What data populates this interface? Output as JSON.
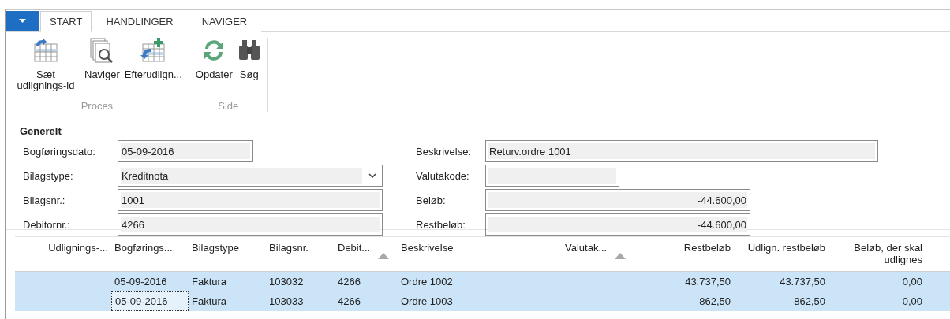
{
  "ribbon": {
    "tabs": [
      {
        "label": "START",
        "selected": true
      },
      {
        "label": "HANDLINGER",
        "selected": false
      },
      {
        "label": "NAVIGER",
        "selected": false
      }
    ],
    "groups": [
      {
        "label": "Proces",
        "buttons": [
          {
            "label": "Sæt udlignings-id",
            "kind": "set-id"
          },
          {
            "label": "Naviger",
            "kind": "navigate"
          },
          {
            "label": "Efterudlign...",
            "kind": "post"
          }
        ]
      },
      {
        "label": "Side",
        "buttons": [
          {
            "label": "Opdater",
            "kind": "refresh"
          },
          {
            "label": "Søg",
            "kind": "find"
          }
        ]
      }
    ]
  },
  "general": {
    "title": "Generelt",
    "left_fields": [
      {
        "label": "Bogføringsdato:",
        "value": "05-09-2016",
        "kind": "text"
      },
      {
        "label": "Bilagstype:",
        "value": "Kreditnota",
        "kind": "select"
      },
      {
        "label": "Bilagsnr.:",
        "value": "1001",
        "kind": "text"
      },
      {
        "label": "Debitornr.:",
        "value": "4266",
        "kind": "text"
      }
    ],
    "right_fields": [
      {
        "label": "Beskrivelse:",
        "value": "Returv.ordre 1001",
        "kind": "text"
      },
      {
        "label": "Valutakode:",
        "kind": "text"
      },
      {
        "label": "Beløb:",
        "value": "-44.600,00",
        "kind": "amount"
      },
      {
        "label": "Restbeløb:",
        "value": "-44.600,00",
        "kind": "amount"
      }
    ]
  },
  "table": {
    "columns": [
      {
        "label": "Udlignings-...",
        "sorted": false
      },
      {
        "label": "Bogførings...",
        "sorted": false
      },
      {
        "label": "Bilagstype",
        "sorted": false
      },
      {
        "label": "Bilagsnr.",
        "sorted": false
      },
      {
        "label": "Debit...",
        "sorted": true
      },
      {
        "label": "Beskrivelse",
        "sorted": false
      },
      {
        "label": "Valutak...",
        "sorted": true
      },
      {
        "label": "Restbeløb",
        "sorted": false
      },
      {
        "label": "Udlign. restbeløb",
        "sorted": false
      },
      {
        "label": "Beløb, der skal udlignes",
        "sorted": false
      }
    ],
    "rows": [
      {
        "selected": true,
        "focused": false,
        "cells": [
          "",
          "05-09-2016",
          "Faktura",
          "103032",
          "4266",
          "Ordre 1002",
          "",
          "43.737,50",
          "43.737,50",
          "0,00"
        ]
      },
      {
        "selected": true,
        "focused": true,
        "cells": [
          "",
          "05-09-2016",
          "Faktura",
          "103033",
          "4266",
          "Ordre 1003",
          "",
          "862,50",
          "862,50",
          "0,00"
        ]
      }
    ]
  }
}
